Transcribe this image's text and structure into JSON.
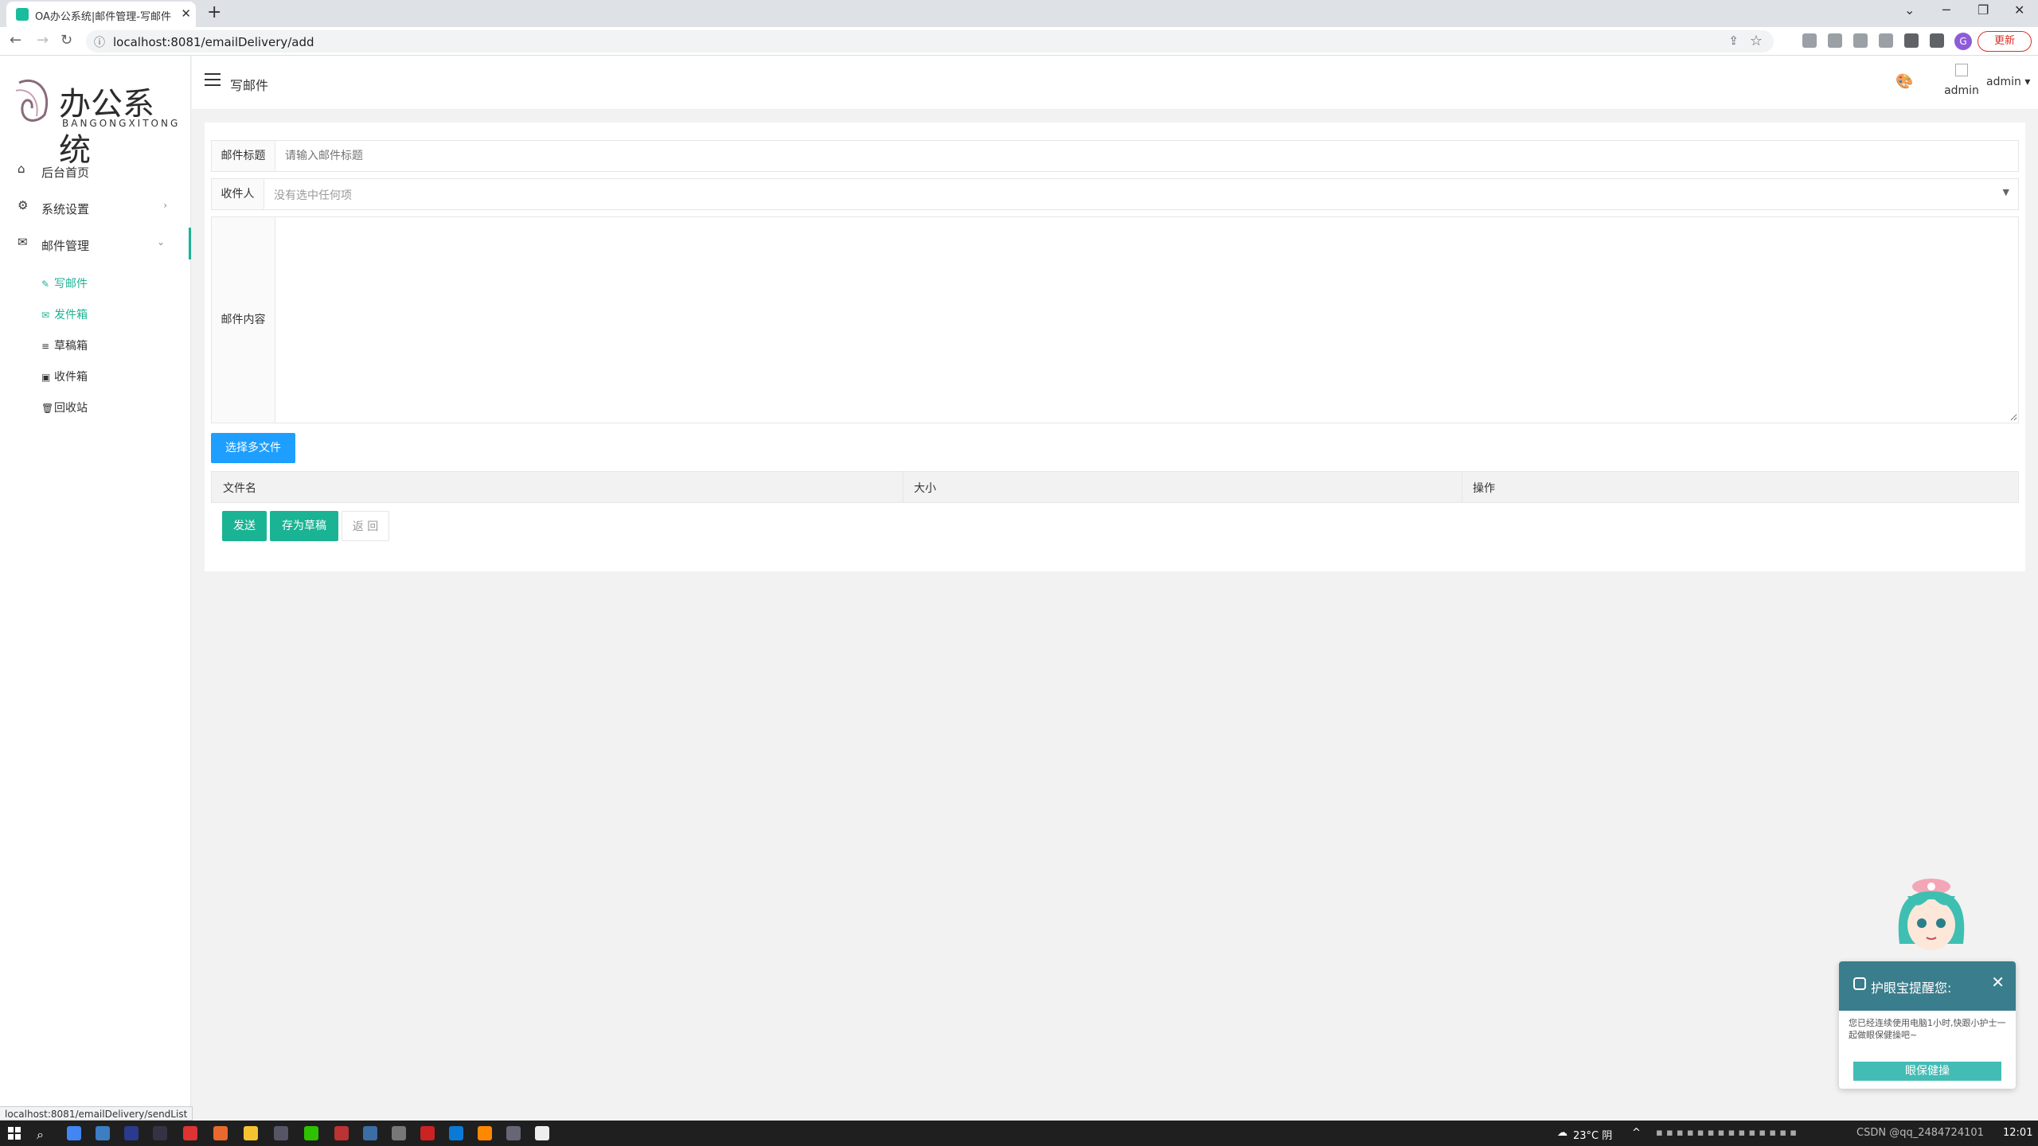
{
  "browser": {
    "tab_title": "OA办公系统|邮件管理-写邮件",
    "new_tab": "+",
    "url": "localhost:8081/emailDelivery/add",
    "profile_initial": "G",
    "update_label": "更新",
    "status_url": "localhost:8081/emailDelivery/sendList"
  },
  "logo": {
    "title": "办公系统",
    "subtitle": "BANGONGXITONG"
  },
  "sidebar": {
    "items": [
      {
        "label": "后台首页",
        "icon": "home-icon"
      },
      {
        "label": "系统设置",
        "icon": "gear-icon",
        "arrow": "›"
      },
      {
        "label": "邮件管理",
        "icon": "envelope-icon",
        "arrow": "⌄"
      }
    ],
    "subitems": [
      {
        "label": "写邮件",
        "icon": "pencil-icon"
      },
      {
        "label": "发件箱",
        "icon": "outbox-icon"
      },
      {
        "label": "草稿箱",
        "icon": "drafts-icon"
      },
      {
        "label": "收件箱",
        "icon": "inbox-icon"
      },
      {
        "label": "回收站",
        "icon": "trash-icon"
      }
    ]
  },
  "header": {
    "title": "写邮件",
    "avatar_alt": "admin",
    "username": "admin"
  },
  "form": {
    "subject_label": "邮件标题",
    "subject_placeholder": "请输入邮件标题",
    "recipient_label": "收件人",
    "recipient_placeholder": "没有选中任何项",
    "content_label": "邮件内容",
    "select_files_label": "选择多文件",
    "table_headers": [
      "文件名",
      "大小",
      "操作"
    ],
    "send_label": "发送",
    "draft_label": "存为草稿",
    "back_label": "返 回"
  },
  "eyecare": {
    "title": "护眼宝提醒您:",
    "message": "您已经连续使用电脑1小时,快跟小护士一起做眼保健操吧~",
    "action": "眼保健操"
  },
  "taskbar": {
    "weather": "23°C 阴",
    "watermark": "CSDN @qq_2484724101",
    "time": "12:01"
  },
  "colors": {
    "accent": "#1ab394",
    "blue_button": "#1e9fff"
  }
}
